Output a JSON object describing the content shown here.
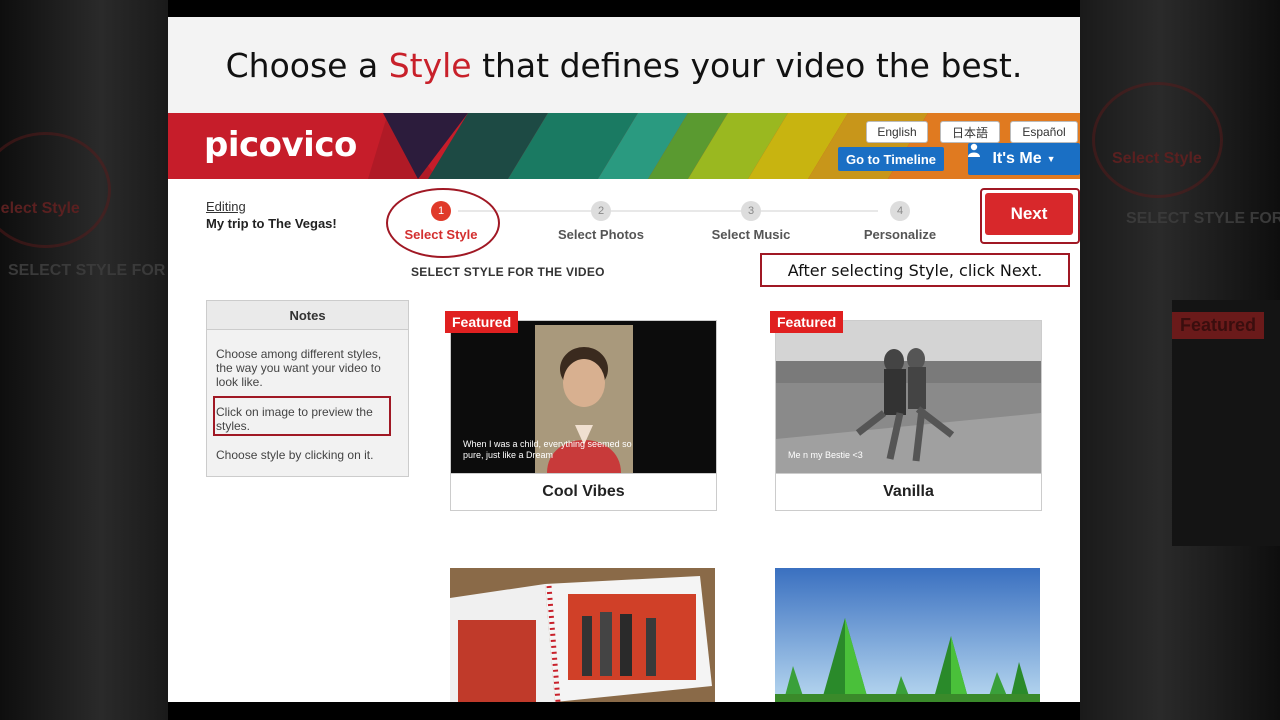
{
  "headline": {
    "prefix": "Choose a ",
    "accent": "Style",
    "suffix": " that defines your video the best."
  },
  "brand": {
    "logo": "picovico"
  },
  "languages": [
    "English",
    "日本語",
    "Español"
  ],
  "header": {
    "timeline_label": "Go to Timeline",
    "user_label": "It's Me"
  },
  "project": {
    "editing_label": "Editing",
    "name": "My trip to The Vegas!"
  },
  "steps": [
    {
      "num": "1",
      "label": "Select Style"
    },
    {
      "num": "2",
      "label": "Select Photos"
    },
    {
      "num": "3",
      "label": "Select Music"
    },
    {
      "num": "4",
      "label": "Personalize"
    }
  ],
  "next_label": "Next",
  "section_title": "SELECT STYLE FOR THE VIDEO",
  "callout": "After selecting Style, click Next.",
  "notes": {
    "title": "Notes",
    "items": [
      "Choose among different styles, the way you want your video to look like.",
      "Click on image to preview the styles.",
      "Choose style by clicking on it."
    ]
  },
  "styles": [
    {
      "name": "Cool Vibes",
      "badge": "Featured",
      "caption": "When I was a child, everything seemed so pure, just like a Dream"
    },
    {
      "name": "Vanilla",
      "badge": "Featured",
      "caption": "Me n my Bestie <3"
    },
    {
      "name": "",
      "badge": ""
    },
    {
      "name": "",
      "badge": ""
    }
  ],
  "colors": {
    "brand_red": "#c61d2a",
    "accent_blue": "#1a6fc4",
    "highlight": "#a01824"
  }
}
